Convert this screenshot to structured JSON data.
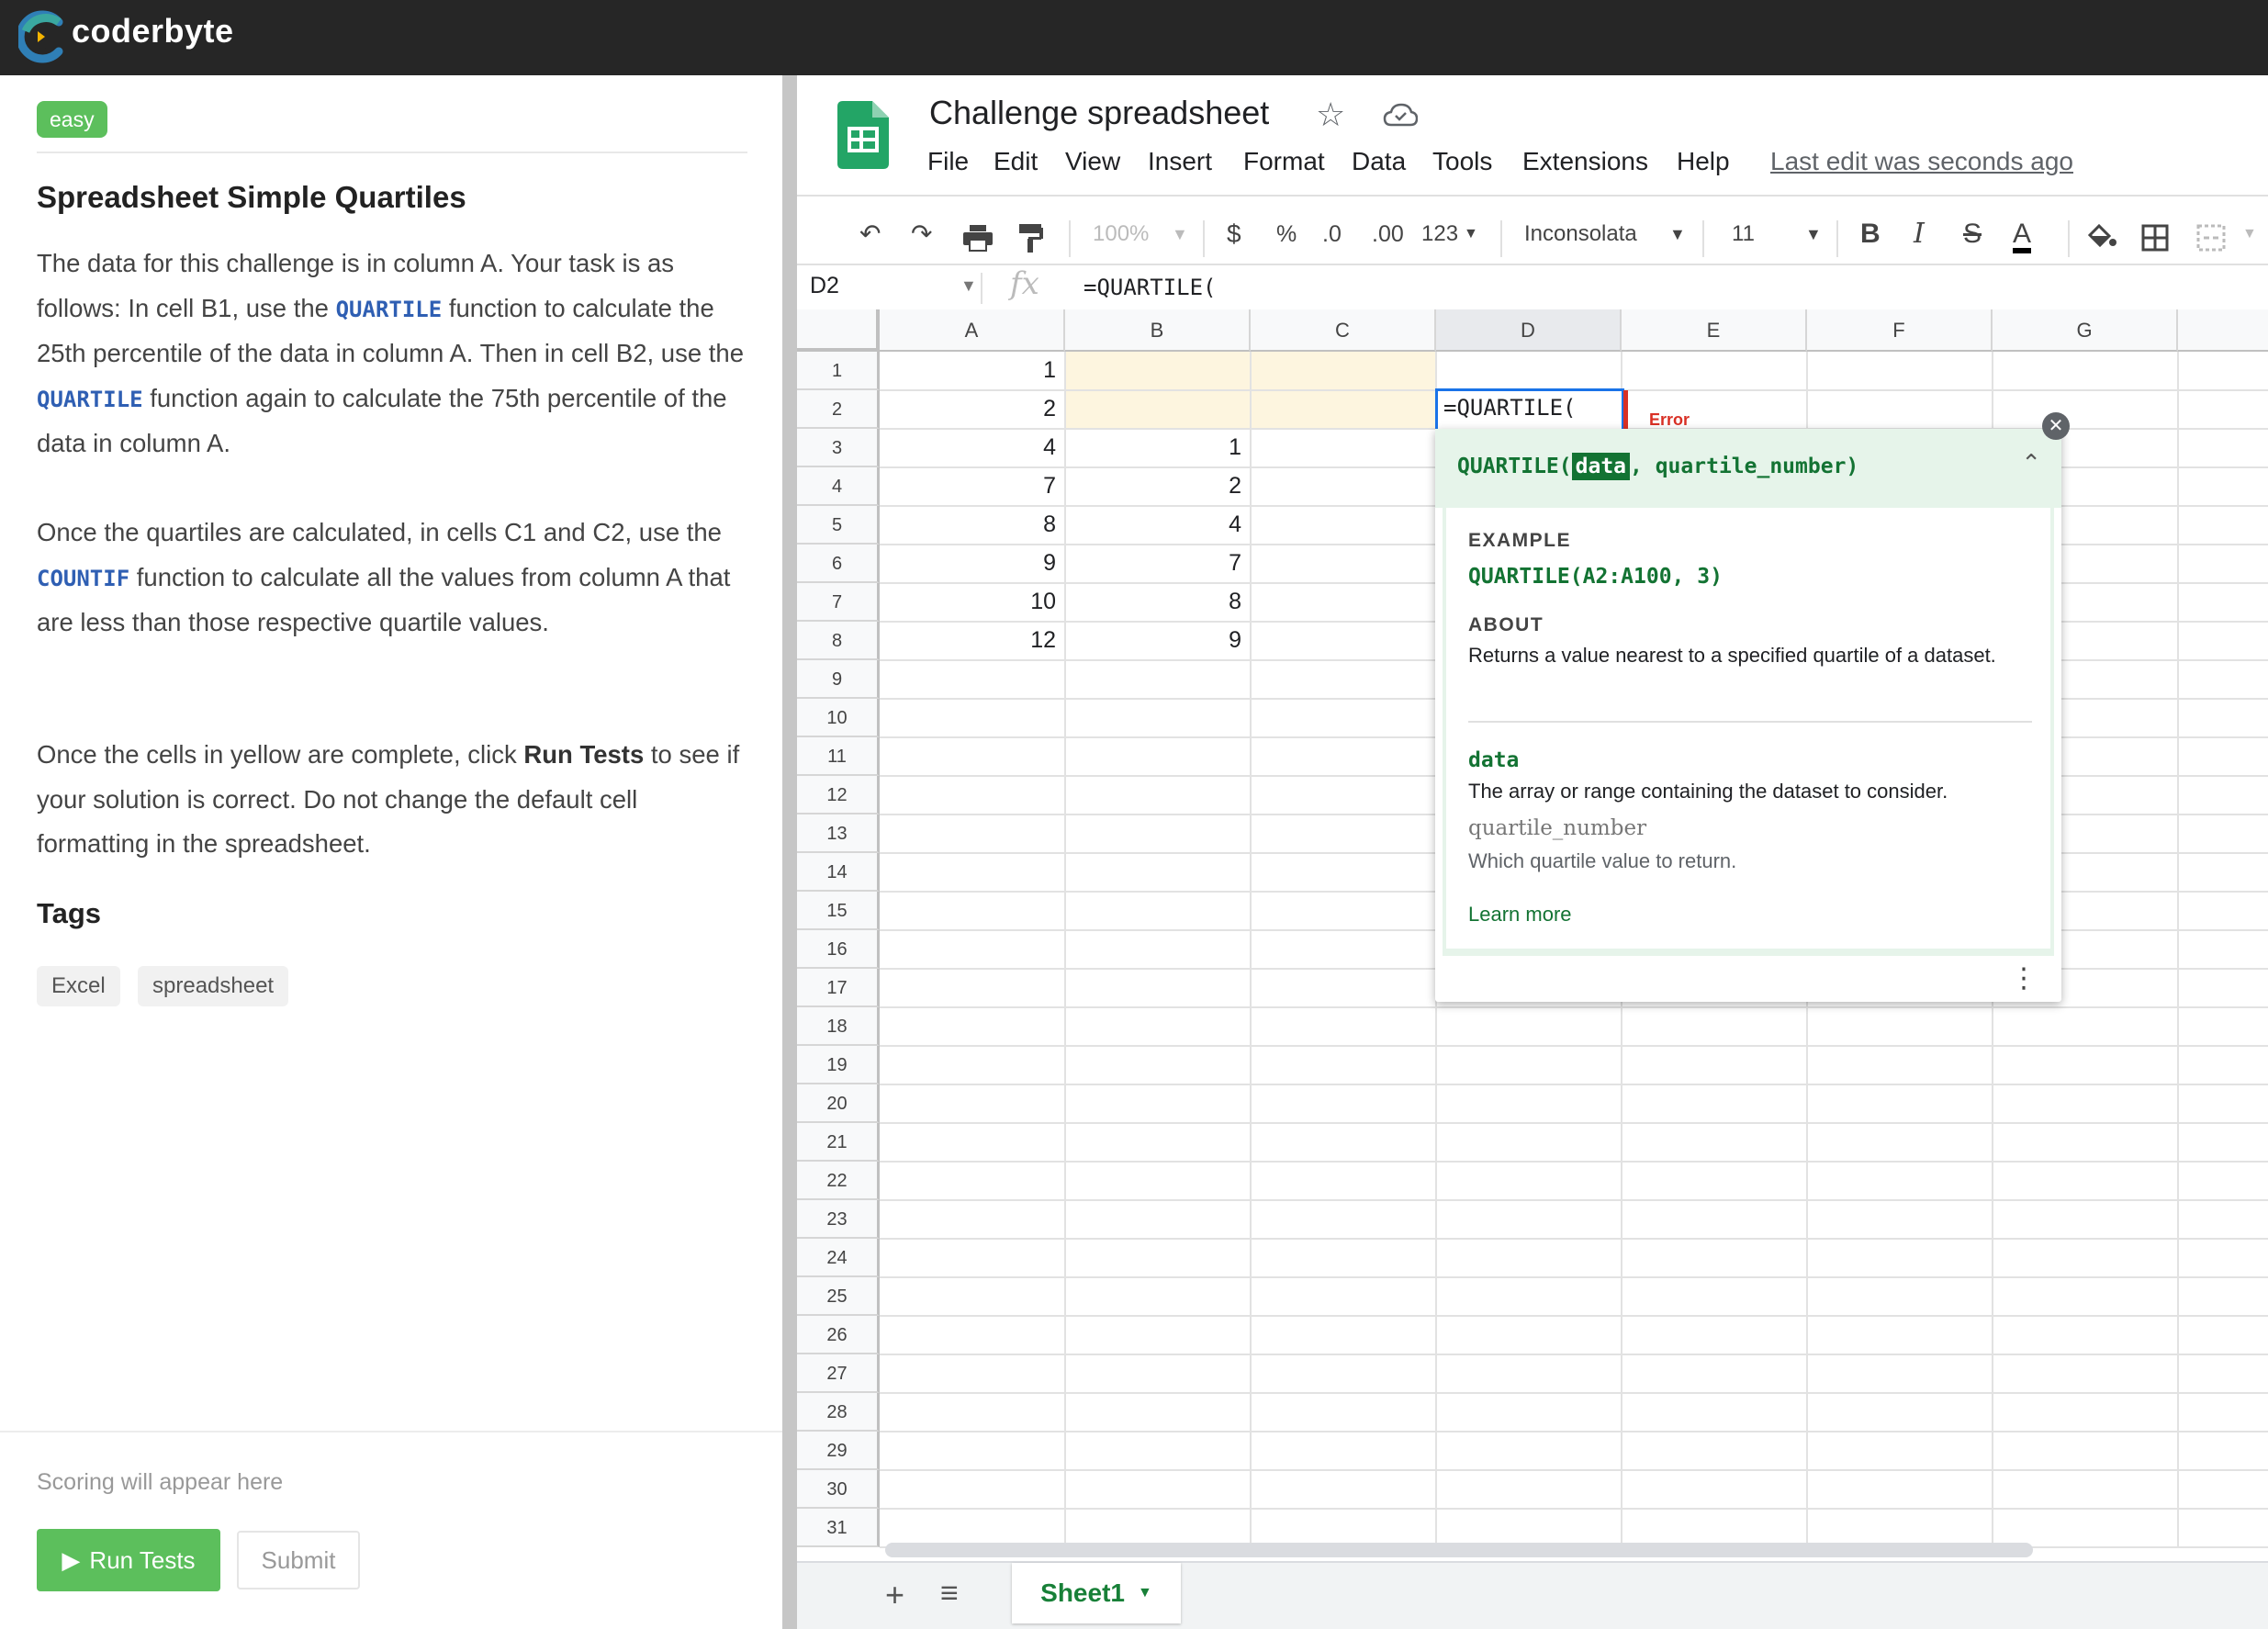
{
  "brand": {
    "name": "coderbyte"
  },
  "challenge": {
    "difficulty": "easy",
    "title": "Spreadsheet Simple Quartiles",
    "p1": [
      "The data for this challenge is in column A. Your task is as follows: In cell B1, use the ",
      "QUARTILE",
      " function to calculate the 25th percentile of the data in column A. Then in cell B2, use the ",
      "QUARTILE",
      " function again to calculate the 75th percentile of the data in column A."
    ],
    "p2": [
      "Once the quartiles are calculated, in cells C1 and C2, use the ",
      "COUNTIF",
      " function to calculate all the values from column A that are less than those respective quartile values."
    ],
    "p3": [
      "Once the cells in yellow are complete, click ",
      "Run Tests",
      " to see if your solution is correct. Do not change the default cell formatting in the spreadsheet."
    ],
    "tags_title": "Tags",
    "tags": [
      "Excel",
      "spreadsheet"
    ],
    "scoring_placeholder": "Scoring will appear here",
    "run_label": "Run Tests",
    "submit_label": "Submit"
  },
  "spreadsheet": {
    "title": "Challenge spreadsheet",
    "menus": [
      "File",
      "Edit",
      "View",
      "Insert",
      "Format",
      "Data",
      "Tools",
      "Extensions",
      "Help"
    ],
    "last_edit": "Last edit was seconds ago",
    "toolbar": {
      "zoom": "100%",
      "currency": "$",
      "percent": "%",
      "dec_decrease": ".0",
      "dec_increase": ".00",
      "more_formats": "123",
      "font": "Inconsolata",
      "font_size": "11"
    },
    "name_box": "D2",
    "formula": "=QUARTILE(",
    "columns": [
      "A",
      "B",
      "C",
      "D",
      "E",
      "F",
      "G"
    ],
    "selected_column": "D",
    "row_count": 31,
    "column_a": [
      1,
      2,
      4,
      7,
      8,
      9,
      10,
      12
    ],
    "column_b_from_row3": [
      1,
      2,
      4,
      7,
      8,
      9
    ],
    "edit_cell_text": "=QUARTILE(",
    "error_text": "Error",
    "help": {
      "fn": "QUARTILE(",
      "arg1": "data",
      "rest": ", quartile_number)",
      "example_label": "EXAMPLE",
      "example": "QUARTILE(A2:A100, 3)",
      "about_label": "ABOUT",
      "about": "Returns a value nearest to a specified quartile of a dataset.",
      "param1_name": "data",
      "param1_desc": "The array or range containing the dataset to consider.",
      "param2_name": "quartile_number",
      "param2_desc": "Which quartile value to return.",
      "learn_more": "Learn more"
    },
    "sheet_tab": "Sheet1"
  },
  "colors": {
    "accent_green": "#5cbf5c",
    "sheets_green": "#188038",
    "highlight_yellow": "#fdf5df",
    "selection_blue": "#1a73e8"
  },
  "icons": [
    "coderbyte-logo-icon",
    "sheets-logo-icon",
    "star-icon",
    "cloud-icon",
    "undo-icon",
    "redo-icon",
    "print-icon",
    "paint-format-icon",
    "bold-icon",
    "italic-icon",
    "strikethrough-icon",
    "text-color-icon",
    "fill-color-icon",
    "borders-icon",
    "merge-icon",
    "play-icon",
    "plus-icon",
    "list-icon",
    "close-icon",
    "chevron-up-icon",
    "more-vert-icon"
  ]
}
